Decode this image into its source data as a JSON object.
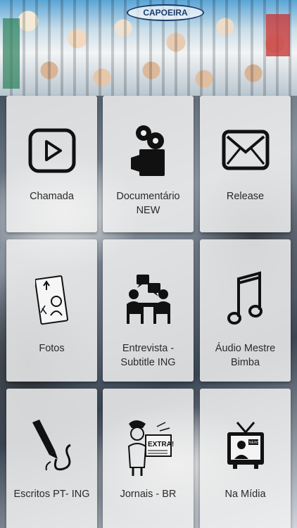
{
  "banner": {
    "sign_text": "CAPOEIRA"
  },
  "tiles": [
    {
      "label": "Chamada",
      "icon": "video-play-icon"
    },
    {
      "label": "Documentário\nNEW",
      "icon": "film-camera-icon"
    },
    {
      "label": "Release",
      "icon": "envelope-icon"
    },
    {
      "label": "Fotos",
      "icon": "photo-sketch-icon"
    },
    {
      "label": "Entrevista -\nSubtitle ING",
      "icon": "interview-icon"
    },
    {
      "label": "Áudio Mestre\nBimba",
      "icon": "music-note-icon"
    },
    {
      "label": "Escritos PT- ING",
      "icon": "fountain-pen-icon"
    },
    {
      "label": "Jornais - BR",
      "icon": "newspaper-boy-icon"
    },
    {
      "label": "Na Mídia",
      "icon": "news-tv-icon"
    }
  ]
}
